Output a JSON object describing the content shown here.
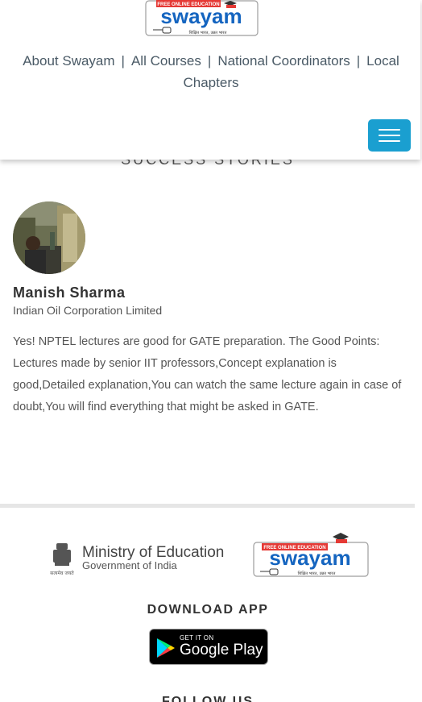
{
  "header": {
    "logo": {
      "tagline": "FREE ONLINE EDUCATION",
      "wordmark": "swayam",
      "subtext": "शिक्षित भारत, उन्नत भारत"
    },
    "nav": [
      {
        "label": "About Swayam"
      },
      {
        "label": "All Courses"
      },
      {
        "label": "National Coordinators"
      },
      {
        "label": "Local Chapters"
      }
    ],
    "separator": "|",
    "menu_icon": "hamburger-menu-icon"
  },
  "section": {
    "title": "SUCCESS STORIES"
  },
  "story": {
    "name": "Manish Sharma",
    "organization": "Indian Oil Corporation Limited",
    "text": "Yes! NPTEL lectures are good for GATE preparation. The Good Points: Lectures made by senior IIT professors,Concept explanation is good,Detailed explanation,You can watch the same lecture again in case of doubt,You will find everything that might be asked in GATE."
  },
  "footer": {
    "ministry": {
      "line1": "Ministry of Education",
      "line2": "Government of India",
      "emblem_text": "सत्यमेव जयते"
    },
    "swayam_logo": {
      "tagline": "FREE ONLINE EDUCATION",
      "wordmark": "swayam",
      "subtext": "शिक्षित भारत, उन्नत भारत"
    },
    "download_title": "DOWNLOAD APP",
    "google_play": {
      "small": "GET IT ON",
      "big": "Google Play"
    },
    "follow_title": "FOLLOW US"
  },
  "colors": {
    "accent": "#1a9fd0",
    "logo_blue": "#1565c0",
    "logo_red": "#e53935",
    "nav_text": "#4a5a66"
  }
}
